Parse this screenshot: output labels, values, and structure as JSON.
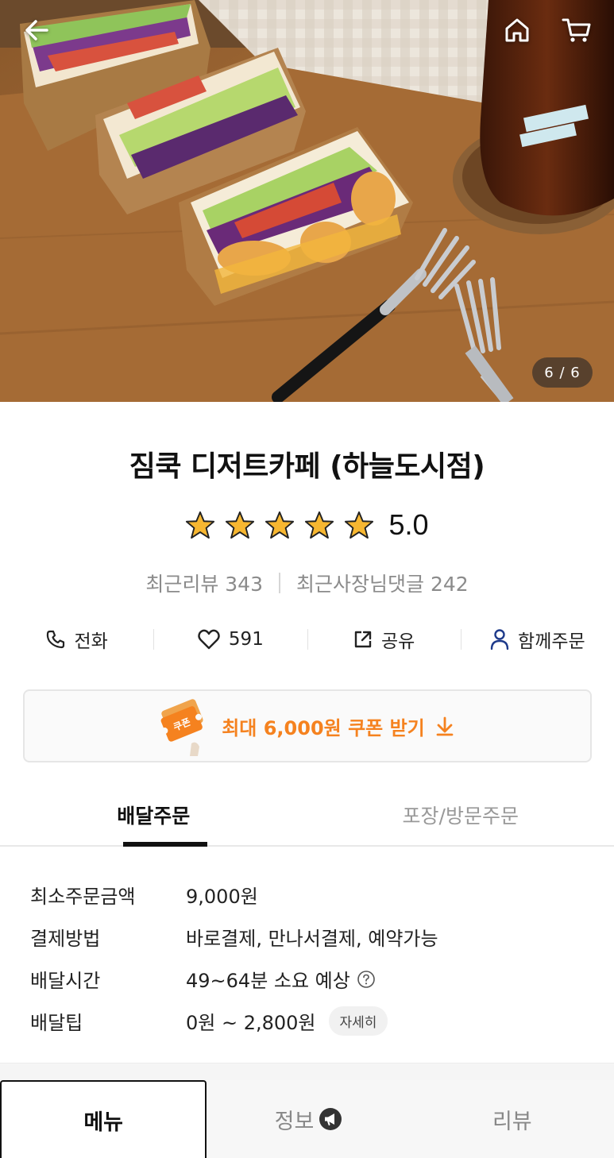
{
  "hero": {
    "image_counter": "6 / 6",
    "back_icon": "back-arrow-icon",
    "home_icon": "home-icon",
    "cart_icon": "cart-icon"
  },
  "store": {
    "name": "짐쿡 디저트카페 (하늘도시점)",
    "rating": "5.0",
    "rating_stars": 5,
    "recent_reviews_label": "최근리뷰 343",
    "recent_owner_replies_label": "최근사장님댓글 242"
  },
  "actions": [
    {
      "label": "전화",
      "icon": "phone-icon"
    },
    {
      "label": "591",
      "icon": "heart-icon"
    },
    {
      "label": "공유",
      "icon": "share-icon"
    },
    {
      "label": "함께주문",
      "icon": "person-icon"
    }
  ],
  "coupon": {
    "label": "최대 6,000원 쿠폰 받기",
    "ticket_text": "쿠폰",
    "accent_color": "#f5821f"
  },
  "order_tabs": [
    {
      "label": "배달주문",
      "active": true
    },
    {
      "label": "포장/방문주문",
      "active": false
    }
  ],
  "info": [
    {
      "label": "최소주문금액",
      "value": "9,000원"
    },
    {
      "label": "결제방법",
      "value": "바로결제, 만나서결제, 예약가능"
    },
    {
      "label": "배달시간",
      "value": "49~64분 소요 예상"
    },
    {
      "label": "배달팁",
      "value": "0원 ~ 2,800원",
      "chip": "자세히"
    }
  ],
  "bottom_tabs": [
    {
      "label": "메뉴",
      "active": true
    },
    {
      "label": "정보",
      "active": false
    },
    {
      "label": "리뷰",
      "active": false
    }
  ]
}
